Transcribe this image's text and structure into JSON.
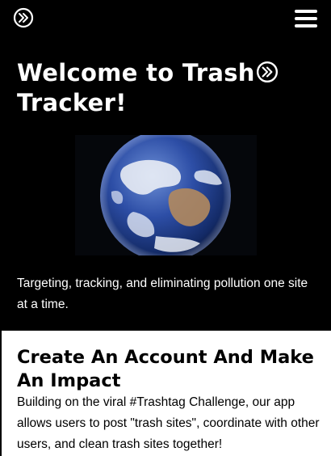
{
  "header": {
    "logo_icon": "circle-double-chevron-right-icon",
    "menu_icon": "hamburger-menu-icon"
  },
  "hero": {
    "title": "Welcome to Trash",
    "title_suffix": "Tracker!",
    "title_icon": "circle-double-chevron-right-icon",
    "image": "earth-globe-photo",
    "tagline": "Targeting, tracking, and eliminating pollution one site at a time."
  },
  "card": {
    "title": "Create An Account And Make An Impact",
    "text": "Building on the viral #Trashtag Challenge, our app allows users to post \"trash sites\", coordinate with other users, and clean trash sites together!"
  },
  "colors": {
    "background": "#000000",
    "text": "#ffffff",
    "card_background": "#ffffff",
    "card_text": "#000000"
  }
}
